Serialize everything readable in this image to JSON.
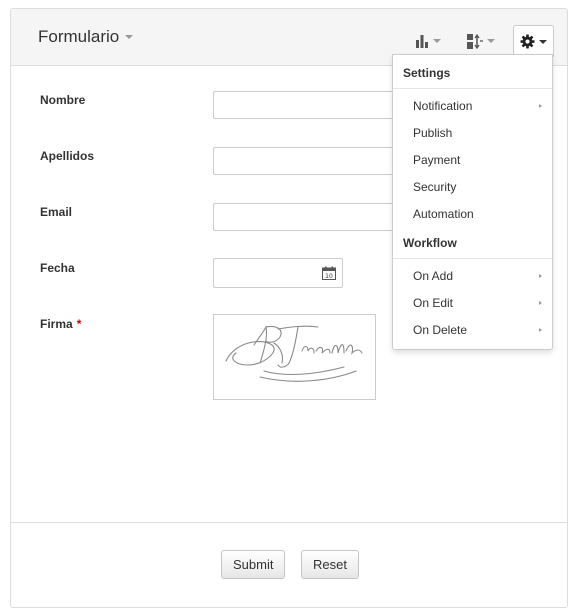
{
  "header": {
    "title": "Formulario"
  },
  "icons": {
    "chart": "bar-chart-icon",
    "layout": "layout-toggle-icon",
    "settings": "gear-icon",
    "calendar": "calendar-icon"
  },
  "form": {
    "fields": [
      {
        "label": "Nombre",
        "value": ""
      },
      {
        "label": "Apellidos",
        "value": ""
      },
      {
        "label": "Email",
        "value": ""
      }
    ],
    "date": {
      "label": "Fecha",
      "value": "",
      "calendar_day": "10"
    },
    "signature": {
      "label": "Firma",
      "required_mark": "*"
    }
  },
  "footer": {
    "submit_label": "Submit",
    "reset_label": "Reset"
  },
  "settings_menu": {
    "settings_header": "Settings",
    "settings_items": [
      {
        "label": "Notification",
        "has_submenu": true
      },
      {
        "label": "Publish",
        "has_submenu": false
      },
      {
        "label": "Payment",
        "has_submenu": false
      },
      {
        "label": "Security",
        "has_submenu": false
      },
      {
        "label": "Automation",
        "has_submenu": false
      }
    ],
    "workflow_header": "Workflow",
    "workflow_items": [
      {
        "label": "On Add",
        "has_submenu": true
      },
      {
        "label": "On Edit",
        "has_submenu": true
      },
      {
        "label": "On Delete",
        "has_submenu": true
      }
    ]
  },
  "colors": {
    "header_bg": "#f5f5f5",
    "border": "#dddddd",
    "required": "#cc0000"
  }
}
